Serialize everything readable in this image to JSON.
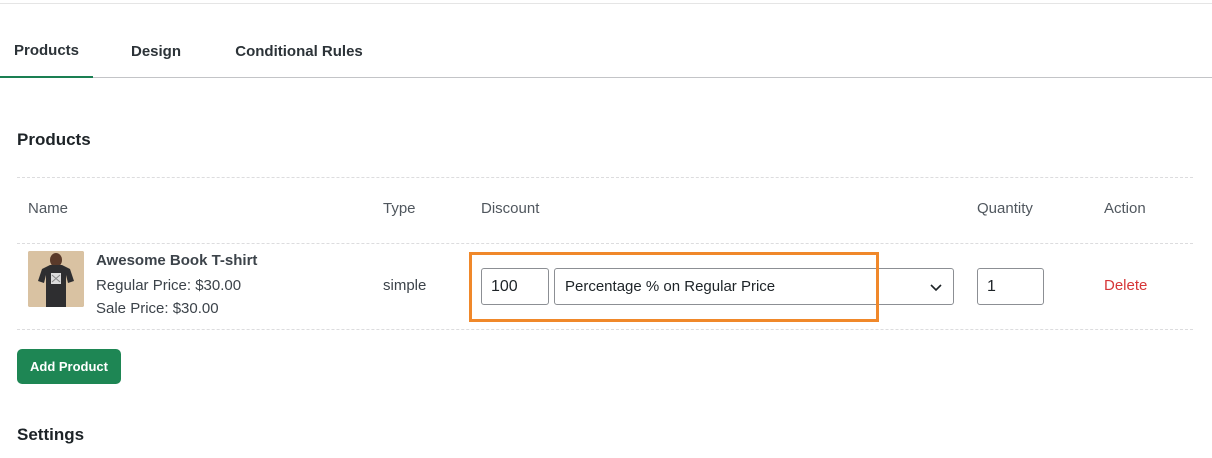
{
  "tabs": [
    {
      "label": "Products",
      "active": true
    },
    {
      "label": "Design",
      "active": false
    },
    {
      "label": "Conditional Rules",
      "active": false
    }
  ],
  "products_section": {
    "title": "Products",
    "columns": [
      "Name",
      "Type",
      "Discount",
      "Quantity",
      "Action"
    ],
    "rows": [
      {
        "name": "Awesome Book T-shirt",
        "regular_price": "Regular Price: $30.00",
        "sale_price": "Sale Price: $30.00",
        "type": "simple",
        "discount_value": "100",
        "discount_type": "Percentage % on Regular Price",
        "quantity": "1",
        "action": "Delete"
      }
    ],
    "add_button": "Add Product"
  },
  "settings_section": {
    "title": "Settings"
  },
  "colors": {
    "accent": "#1e8654",
    "highlight": "#f0882a",
    "danger": "#d63638"
  }
}
